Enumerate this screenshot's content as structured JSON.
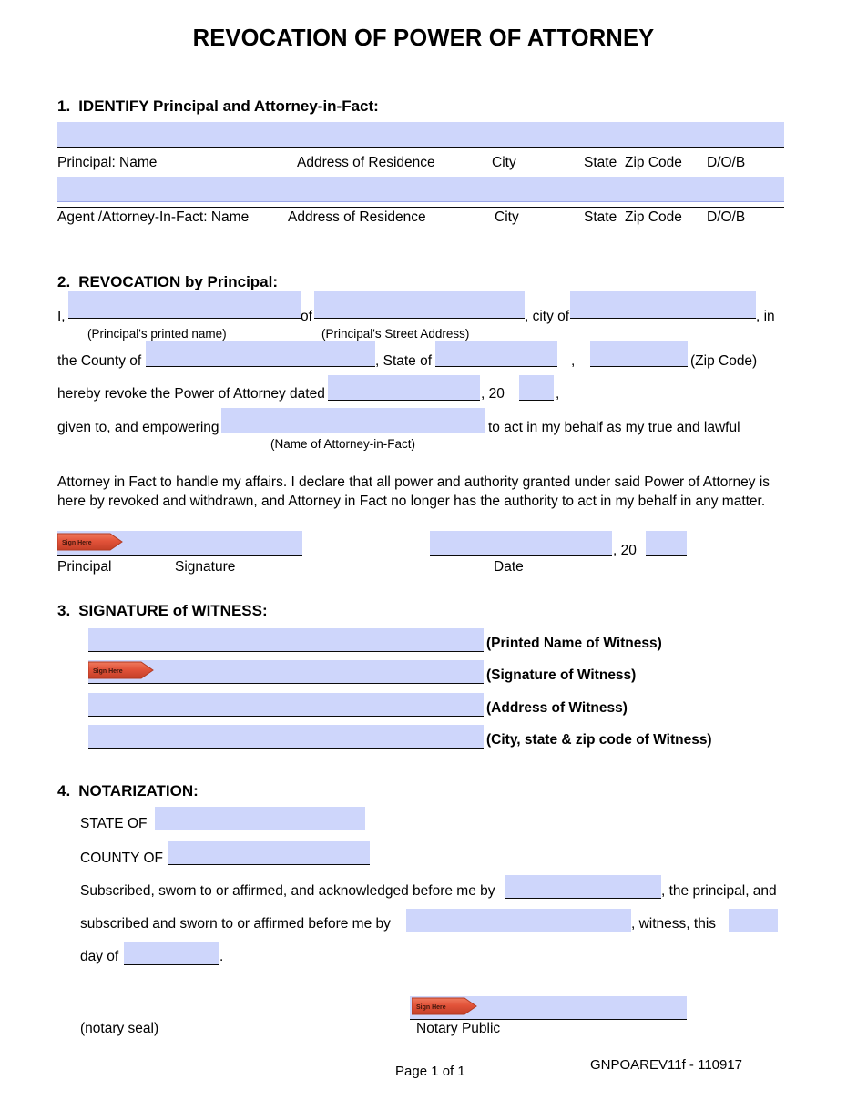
{
  "document": {
    "title": "REVOCATION OF POWER OF ATTORNEY",
    "form_code": "GNPOAREV11f - 110917",
    "page_label": "Page 1 of 1",
    "field_fill_color": "#ced6fb",
    "sign_tag_color": "#e2533a",
    "sign_tag_label": "Sign Here"
  },
  "section1": {
    "number": "1.",
    "heading": "IDENTIFY Principal and Attorney-in-Fact:",
    "rows": [
      {
        "labels": [
          "Principal: Name",
          "Address of Residence",
          "City",
          "State",
          "Zip Code",
          "D/O/B"
        ],
        "value": ""
      },
      {
        "labels": [
          "Agent /Attorney-In-Fact: Name",
          "Address of Residence",
          "City",
          "State",
          "Zip Code",
          "D/O/B"
        ],
        "value": ""
      }
    ]
  },
  "section2": {
    "number": "2.",
    "heading": "REVOCATION by Principal:",
    "line1": {
      "lead": "I,",
      "of": "of",
      "city_of": ", city of",
      "in": ", in",
      "caption_name": "(Principal's printed name)",
      "caption_address": "(Principal's Street Address)",
      "value_name": "",
      "value_address": "",
      "value_city": ""
    },
    "line2": {
      "county_of": "the County of",
      "state_of": ", State of",
      "comma": ",",
      "zip_caption": "(Zip Code)",
      "value_county": "",
      "value_state": "",
      "value_zip": ""
    },
    "line3": {
      "lead": "hereby revoke the Power of Attorney dated",
      "year_prefix": ", 20",
      "trailing_comma": ",",
      "value_date": "",
      "value_year": ""
    },
    "line4": {
      "lead": "given to, and empowering",
      "trail": "to act in my behalf as my true and lawful",
      "caption": "(Name of Attorney-in-Fact)",
      "value_aif_name": ""
    },
    "paragraph": "Attorney in Fact to handle my affairs. I declare that all power and authority granted under said Power of Attorney is here by revoked and withdrawn, and Attorney in Fact no longer has the authority to act in my behalf in any matter.",
    "signature_block": {
      "principal_label": "Principal",
      "signature_label": "Signature",
      "date_label": "Date",
      "year_prefix": ", 20",
      "value_signature": "",
      "value_date": "",
      "value_year": ""
    }
  },
  "section3": {
    "number": "3.",
    "heading": "SIGNATURE of WITNESS:",
    "fields": [
      {
        "caption": "(Printed Name of Witness)",
        "value": "",
        "has_sign_tag": false
      },
      {
        "caption": "(Signature of Witness)",
        "value": "",
        "has_sign_tag": true
      },
      {
        "caption": "(Address of Witness)",
        "value": "",
        "has_sign_tag": false
      },
      {
        "caption": "(City, state & zip code of Witness)",
        "value": "",
        "has_sign_tag": false
      }
    ]
  },
  "section4": {
    "number": "4.",
    "heading": "NOTARIZATION:",
    "state_of_label": "STATE OF",
    "state_of_value": "",
    "county_of_label": "COUNTY OF",
    "county_of_value": "",
    "line1_a": "Subscribed, sworn to or affirmed, and acknowledged before me by",
    "line1_b": ", the principal, and",
    "line1_value": "",
    "line2_a": "subscribed and sworn to or affirmed before me by",
    "line2_b": ", witness, this",
    "line2_value": "",
    "line2_day_value": "",
    "line3_a": "day of",
    "line3_b": ".",
    "line3_value": "",
    "seal_label": "(notary seal)",
    "notary_public_label": "Notary Public",
    "notary_signature_value": ""
  }
}
